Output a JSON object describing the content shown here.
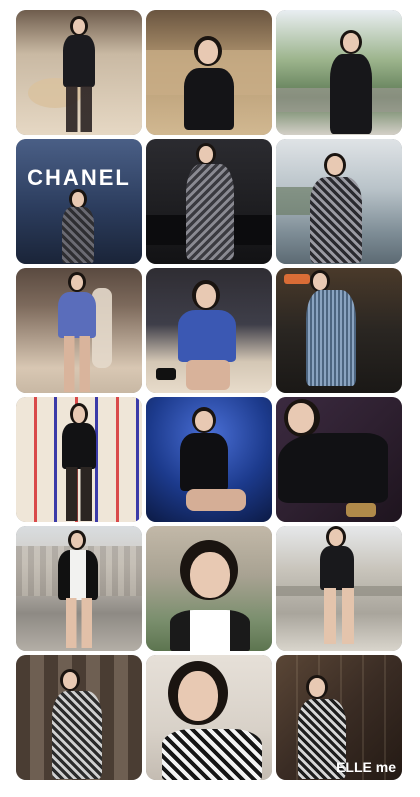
{
  "grid": {
    "tiles": [
      {
        "scene": "event-lounge",
        "bg": "#c9b9a3",
        "outfit": "#1b1b1f"
      },
      {
        "scene": "sofa-seated",
        "bg": "#b79b74",
        "outfit": "#141417"
      },
      {
        "scene": "outdoor-park",
        "bg": "#8aa27c",
        "outfit": "#17171a"
      },
      {
        "scene": "chanel-night",
        "bg": "#2c3d5e",
        "outfit": "#3b3b3f",
        "text": "CHANEL"
      },
      {
        "scene": "dark-seated",
        "bg": "#1d1d20",
        "outfit": "#5b5b62"
      },
      {
        "scene": "riverside",
        "bg": "#b9c3c9",
        "outfit": "#3a3a40"
      },
      {
        "scene": "runway-crowd",
        "bg": "#b9a998",
        "outfit": "#5a6dbb"
      },
      {
        "scene": "front-row-blue",
        "bg": "#3e3e49",
        "outfit": "#3b58b3"
      },
      {
        "scene": "night-city",
        "bg": "#2a2622",
        "outfit": "#5f7896"
      },
      {
        "scene": "poster-wall",
        "bg": "#e9dfd0",
        "outfit": "#121214"
      },
      {
        "scene": "blue-stage",
        "bg": "#1c3a8c",
        "outfit": "#0f0f12"
      },
      {
        "scene": "purple-closeup",
        "bg": "#2e2030",
        "outfit": "#111114"
      },
      {
        "scene": "paris-rooftop",
        "bg": "#cfcac3",
        "outfit": "#f2f2f0"
      },
      {
        "scene": "louvre-portrait",
        "bg": "#9aa59b",
        "outfit": "#ffffff"
      },
      {
        "scene": "plaza-steps",
        "bg": "#c8c4bb",
        "outfit": "#19191c"
      },
      {
        "scene": "mirror-room",
        "bg": "#5b4c40",
        "outfit": "#6f6f74"
      },
      {
        "scene": "houndstooth-closeup",
        "bg": "#d8d1c8",
        "outfit": "#3a3a3a"
      },
      {
        "scene": "magazine-mirror",
        "bg": "#3a2c24",
        "outfit": "#5c5c60",
        "text": "ELLE me"
      }
    ]
  }
}
